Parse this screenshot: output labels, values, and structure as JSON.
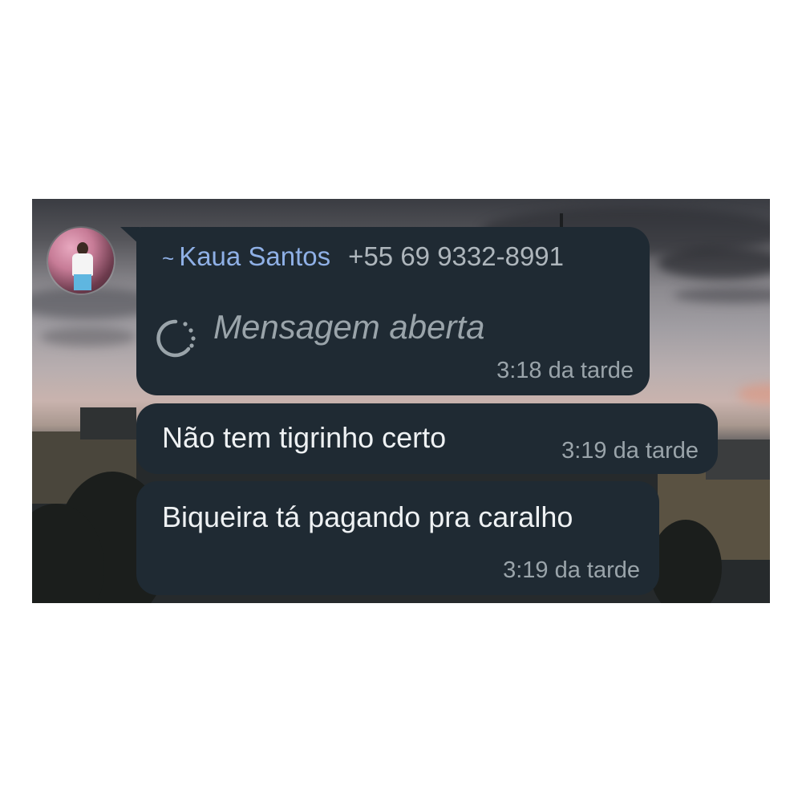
{
  "chat": {
    "sender": {
      "prefix": "~",
      "name": "Kaua Santos",
      "phone": "+55 69 9332-8991"
    },
    "messages": [
      {
        "type": "view-once-opened",
        "text": "Mensagem aberta",
        "time": "3:18 da tarde"
      },
      {
        "type": "text",
        "text": "Não tem tigrinho certo",
        "time": "3:19 da tarde"
      },
      {
        "type": "text",
        "text": "Biqueira tá pagando pra caralho",
        "time": "3:19 da tarde"
      }
    ]
  },
  "colors": {
    "bubble": "#1f2a33",
    "sender_name": "#8fb0e6",
    "meta_text": "#9aa4aa",
    "message_text": "#eef1f3"
  },
  "icons": {
    "avatar": "avatar-photo",
    "opened": "view-once-opened-icon"
  }
}
